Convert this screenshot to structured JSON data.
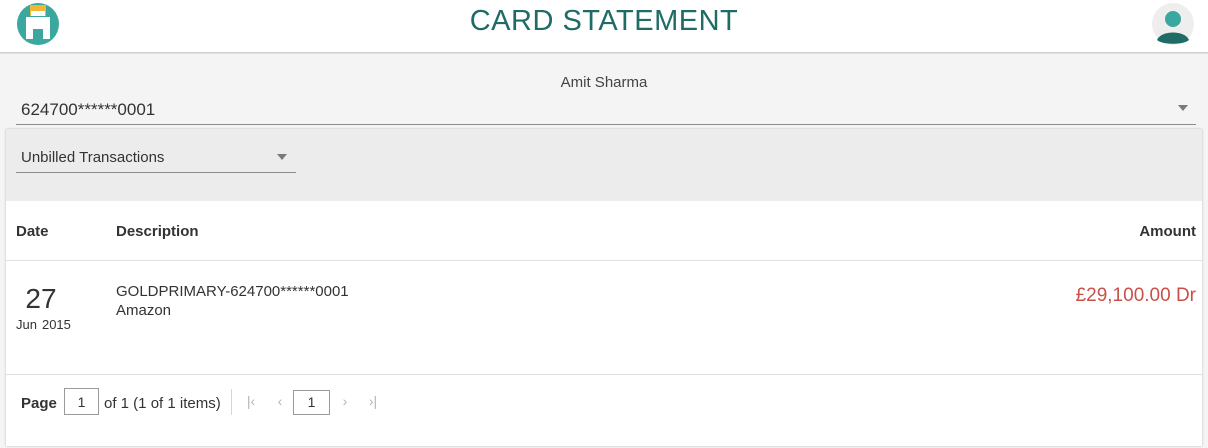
{
  "header": {
    "title": "CARD STATEMENT",
    "logo_icon": "bank-app-logo-icon",
    "avatar_icon": "user-avatar-icon"
  },
  "account": {
    "holder_name": "Amit Sharma",
    "card_number": "624700******0001"
  },
  "filter": {
    "selected": "Unbilled Transactions"
  },
  "table": {
    "columns": [
      "Date",
      "Description",
      "Amount"
    ],
    "rows": [
      {
        "day": "27",
        "month": "Jun",
        "year": "2015",
        "description_line1": "GOLDPRIMARY-624700******0001",
        "description_line2": "Amazon",
        "amount": "£29,100.00 Dr"
      }
    ]
  },
  "pagination": {
    "label": "Page",
    "current_page": "1",
    "summary": "of 1 (1 of 1 items)",
    "page_button": "1"
  },
  "colors": {
    "title": "#1f6b66",
    "debit_amount": "#c9504a",
    "logo_teal": "#3aa89e",
    "logo_yellow": "#f2b632"
  }
}
